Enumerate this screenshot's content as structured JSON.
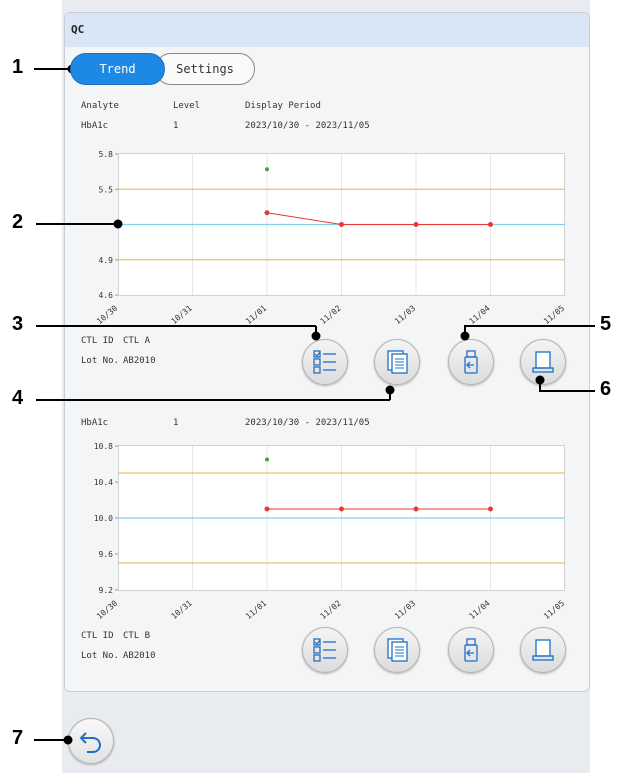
{
  "panel": {
    "title": "QC"
  },
  "tabs": [
    {
      "label": "Trend",
      "active": true
    },
    {
      "label": "Settings",
      "active": false
    }
  ],
  "headers": {
    "analyte": "Analyte",
    "level": "Level",
    "display_period": "Display Period"
  },
  "section1": {
    "analyte": "HbA1c",
    "level": "1",
    "period": "2023/10/30 - 2023/11/05",
    "ctl_id_label": "CTL ID",
    "ctl_id": "CTL A",
    "lot_label": "Lot No.",
    "lot": "AB2010"
  },
  "section2": {
    "analyte": "HbA1c",
    "level": "1",
    "period": "2023/10/30 - 2023/11/05",
    "ctl_id_label": "CTL ID",
    "ctl_id": "CTL B",
    "lot_label": "Lot No.",
    "lot": "AB2010"
  },
  "buttons": {
    "list": "list-icon",
    "report": "document-icon",
    "export": "usb-export-icon",
    "print": "print-icon",
    "back": "back-arrow-icon"
  },
  "callouts": [
    "1",
    "2",
    "3",
    "4",
    "5",
    "6",
    "7"
  ],
  "colors": {
    "accent": "#1e88e5",
    "mean_line": "#7fd3e8",
    "limit_line": "#e8c36a",
    "data_point": "#e53935",
    "outlier_point": "#43a047"
  },
  "chart_data": [
    {
      "type": "line",
      "categories": [
        "10/30",
        "10/31",
        "11/01",
        "11/02",
        "11/03",
        "11/04",
        "11/05"
      ],
      "y_ticks": [
        "5.8",
        "5.5",
        "4.9",
        "4.6"
      ],
      "ylim": [
        4.6,
        5.8
      ],
      "mean": 5.2,
      "limits": [
        5.5,
        4.9
      ],
      "series": [
        {
          "x": [
            "11/01",
            "11/02",
            "11/03",
            "11/04"
          ],
          "values": [
            5.3,
            5.2,
            5.2,
            5.2
          ]
        }
      ],
      "outliers": [
        {
          "x": "11/01",
          "value": 5.67
        }
      ]
    },
    {
      "type": "line",
      "categories": [
        "10/30",
        "10/31",
        "11/01",
        "11/02",
        "11/03",
        "11/04",
        "11/05"
      ],
      "y_ticks": [
        "10.8",
        "10.4",
        "10.0",
        "9.6",
        "9.2"
      ],
      "ylim": [
        9.2,
        10.8
      ],
      "mean": 10.0,
      "limits": [
        10.5,
        9.5
      ],
      "series": [
        {
          "x": [
            "11/01",
            "11/02",
            "11/03",
            "11/04"
          ],
          "values": [
            10.1,
            10.1,
            10.1,
            10.1
          ]
        }
      ],
      "outliers": [
        {
          "x": "11/01",
          "value": 10.65
        }
      ]
    }
  ]
}
